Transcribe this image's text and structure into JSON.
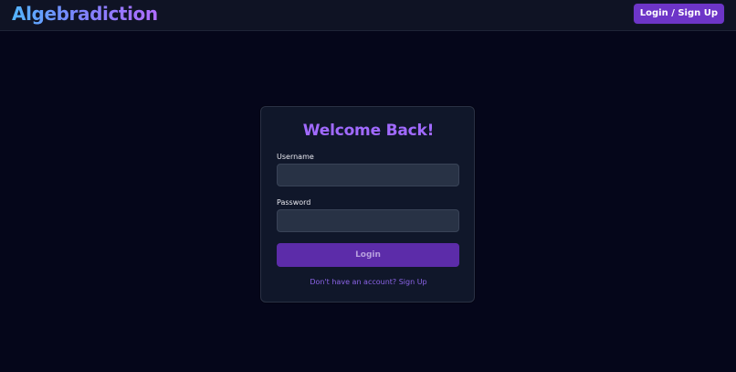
{
  "header": {
    "brand": "Algebradiction",
    "login_signup": "Login / Sign Up"
  },
  "login_card": {
    "title": "Welcome Back!",
    "username": {
      "label": "Username",
      "value": "",
      "placeholder": ""
    },
    "password": {
      "label": "Password",
      "value": "",
      "placeholder": ""
    },
    "login_button": "Login",
    "signup_link": "Don't have an account? Sign Up"
  },
  "colors": {
    "page_background": "#05061a",
    "navbar_background": "#0f1324",
    "card_background": "#10172a",
    "accent_purple": "#6d35c8",
    "title_purple": "#a16aff",
    "input_background": "#283245"
  }
}
